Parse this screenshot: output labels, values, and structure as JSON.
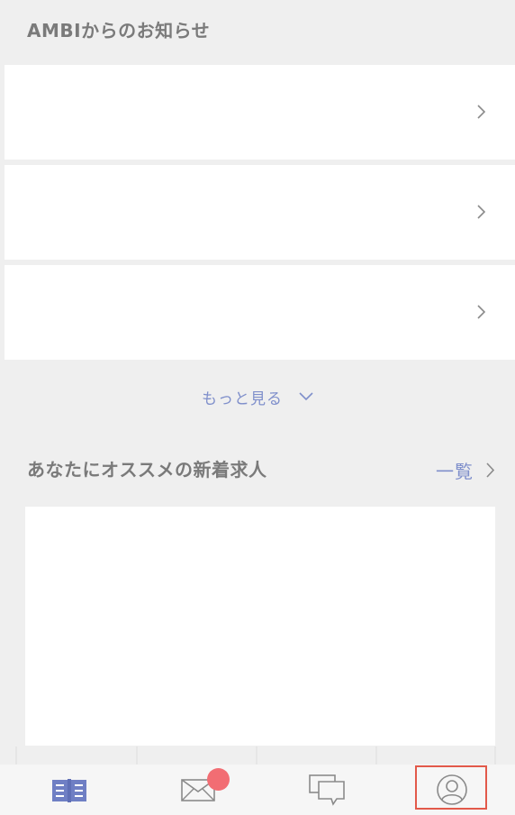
{
  "notices": {
    "title": "AMBIからのお知らせ",
    "items": [
      {
        "text": ""
      },
      {
        "text": ""
      },
      {
        "text": ""
      }
    ],
    "more_label": "もっと見る"
  },
  "recommended": {
    "title": "あなたにオススメの新着求人",
    "list_label": "一覧"
  },
  "tabbar": {
    "tabs": [
      {
        "name": "book",
        "icon": "book-icon",
        "active": true
      },
      {
        "name": "messages",
        "icon": "envelope-icon",
        "badge": true
      },
      {
        "name": "chat",
        "icon": "chat-bubbles-icon"
      },
      {
        "name": "profile",
        "icon": "user-profile-icon",
        "highlighted": true
      }
    ]
  },
  "colors": {
    "background": "#efefef",
    "accent": "#7f8fcb",
    "badge": "#f26d73",
    "highlight": "#e2594a",
    "title_text": "#7a7a7a",
    "icon_gray": "#8a8a8a"
  }
}
